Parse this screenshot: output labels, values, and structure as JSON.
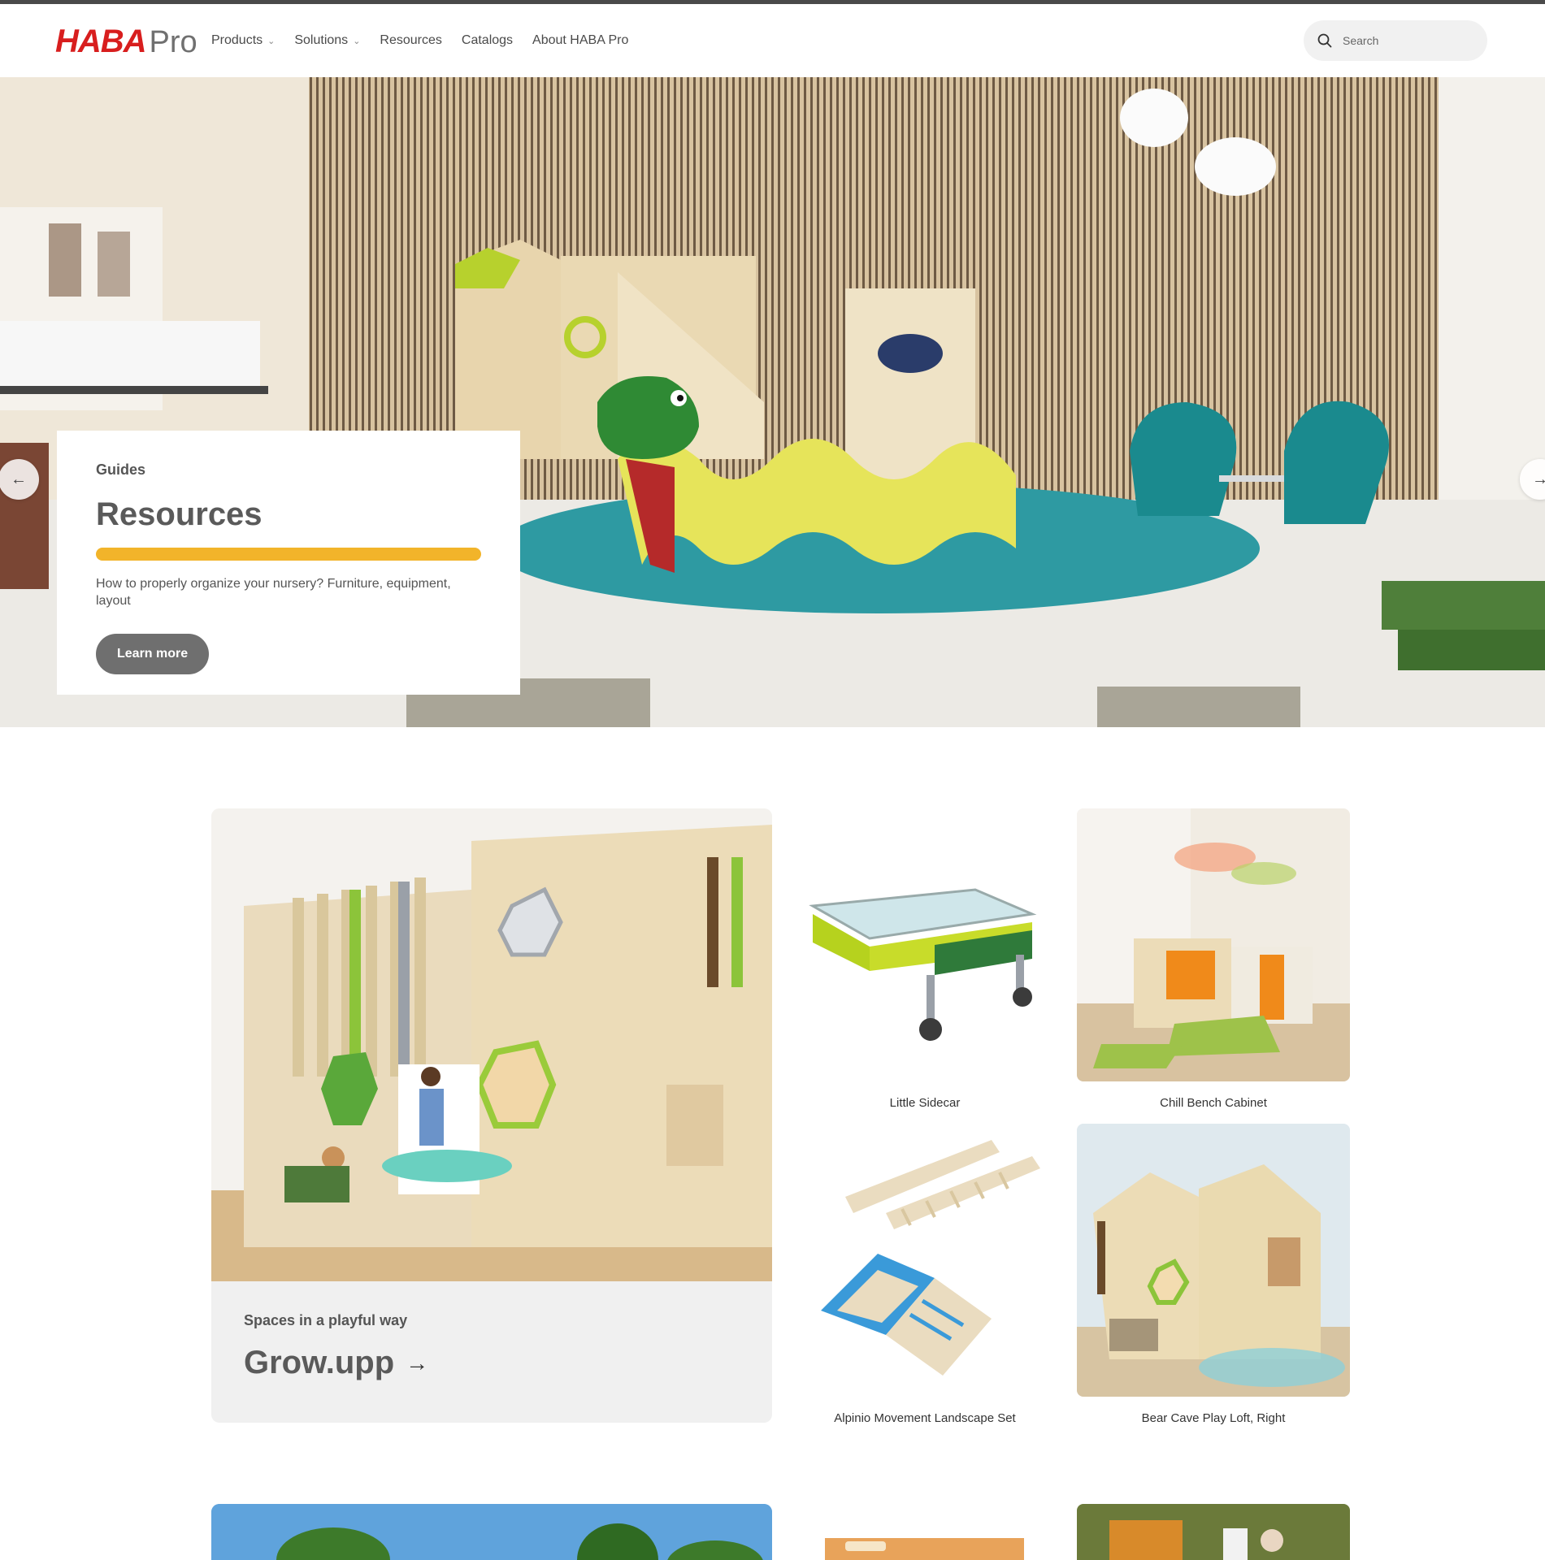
{
  "header": {
    "logo_brand": "HABA",
    "logo_suffix": "Pro",
    "nav": [
      {
        "label": "Products",
        "has_dropdown": true
      },
      {
        "label": "Solutions",
        "has_dropdown": true
      },
      {
        "label": "Resources",
        "has_dropdown": false
      },
      {
        "label": "Catalogs",
        "has_dropdown": false
      },
      {
        "label": "About HABA Pro",
        "has_dropdown": false
      }
    ],
    "search_placeholder": "Search"
  },
  "hero": {
    "eyebrow": "Guides",
    "title": "Resources",
    "description": "How to properly organize your nursery? Furniture, equipment, layout",
    "cta": "Learn more",
    "accent_color": "#f2b42a",
    "prev_icon": "arrow-left-icon",
    "next_icon": "arrow-right-icon"
  },
  "feature": {
    "subtitle": "Spaces in a playful way",
    "title": "Grow.upp",
    "arrow": "→"
  },
  "products": [
    {
      "label": "Little Sidecar"
    },
    {
      "label": "Chill Bench Cabinet"
    },
    {
      "label": "Alpinio Movement Landscape Set"
    },
    {
      "label": "Bear Cave Play Loft, Right"
    }
  ],
  "colors": {
    "brand_red": "#d81e1e",
    "button_gray": "#6f6f6f"
  }
}
